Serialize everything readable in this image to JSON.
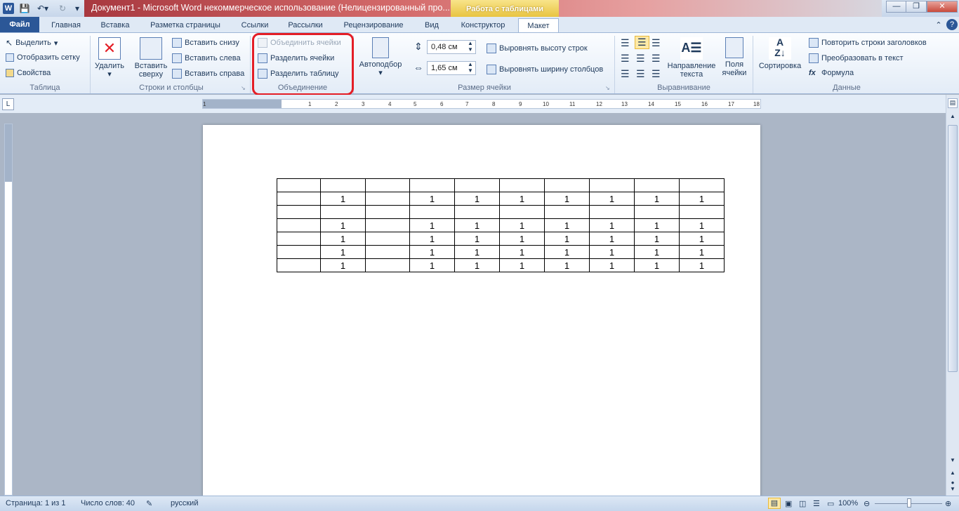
{
  "titlebar": {
    "title": "Документ1 - Microsoft Word некоммерческое использование (Нелицензированный про...",
    "context_group": "Работа с таблицами",
    "app_icon": "W"
  },
  "tabs": {
    "file": "Файл",
    "items": [
      "Главная",
      "Вставка",
      "Разметка страницы",
      "Ссылки",
      "Рассылки",
      "Рецензирование",
      "Вид",
      "Конструктор",
      "Макет"
    ],
    "active": "Макет"
  },
  "ribbon": {
    "table_group": {
      "label": "Таблица",
      "select": "Выделить",
      "show_grid": "Отобразить сетку",
      "properties": "Свойства"
    },
    "rows_cols_group": {
      "label": "Строки и столбцы",
      "delete": "Удалить",
      "insert_above_1": "Вставить",
      "insert_above_2": "сверху",
      "insert_below": "Вставить снизу",
      "insert_left": "Вставить слева",
      "insert_right": "Вставить справа"
    },
    "merge_group": {
      "label": "Объединение",
      "merge_cells": "Объединить ячейки",
      "split_cells": "Разделить ячейки",
      "split_table": "Разделить таблицу"
    },
    "cell_size_group": {
      "label": "Размер ячейки",
      "autofit": "Автоподбор",
      "height_value": "0,48 см",
      "width_value": "1,65 см",
      "distribute_rows": "Выровнять высоту строк",
      "distribute_cols": "Выровнять ширину столбцов"
    },
    "alignment_group": {
      "label": "Выравнивание",
      "text_direction_1": "Направление",
      "text_direction_2": "текста",
      "cell_margins_1": "Поля",
      "cell_margins_2": "ячейки"
    },
    "data_group": {
      "label": "Данные",
      "sort": "Сортировка",
      "repeat_header": "Повторить строки заголовков",
      "convert_text": "Преобразовать в текст",
      "formula": "Формула"
    }
  },
  "ruler_numbers": [
    "1",
    "1",
    "2",
    "3",
    "4",
    "5",
    "6",
    "7",
    "8",
    "9",
    "10",
    "11",
    "12",
    "13",
    "14",
    "15",
    "16",
    "17",
    "18"
  ],
  "document": {
    "table_rows": [
      [
        "",
        "",
        "",
        "",
        "",
        "",
        "",
        "",
        "",
        ""
      ],
      [
        "",
        "1",
        "",
        "1",
        "1",
        "1",
        "1",
        "1",
        "1",
        "1"
      ],
      [
        "",
        "",
        "",
        "",
        "",
        "",
        "",
        "",
        "",
        ""
      ],
      [
        "",
        "1",
        "",
        "1",
        "1",
        "1",
        "1",
        "1",
        "1",
        "1"
      ],
      [
        "",
        "1",
        "",
        "1",
        "1",
        "1",
        "1",
        "1",
        "1",
        "1"
      ],
      [
        "",
        "1",
        "",
        "1",
        "1",
        "1",
        "1",
        "1",
        "1",
        "1"
      ],
      [
        "",
        "1",
        "",
        "1",
        "1",
        "1",
        "1",
        "1",
        "1",
        "1"
      ]
    ]
  },
  "statusbar": {
    "page": "Страница: 1 из 1",
    "words": "Число слов: 40",
    "language": "русский",
    "zoom": "100%"
  },
  "colors": {
    "highlight": "#e41e26",
    "file_tab": "#2b5797",
    "context_tab": "#e8c441"
  }
}
